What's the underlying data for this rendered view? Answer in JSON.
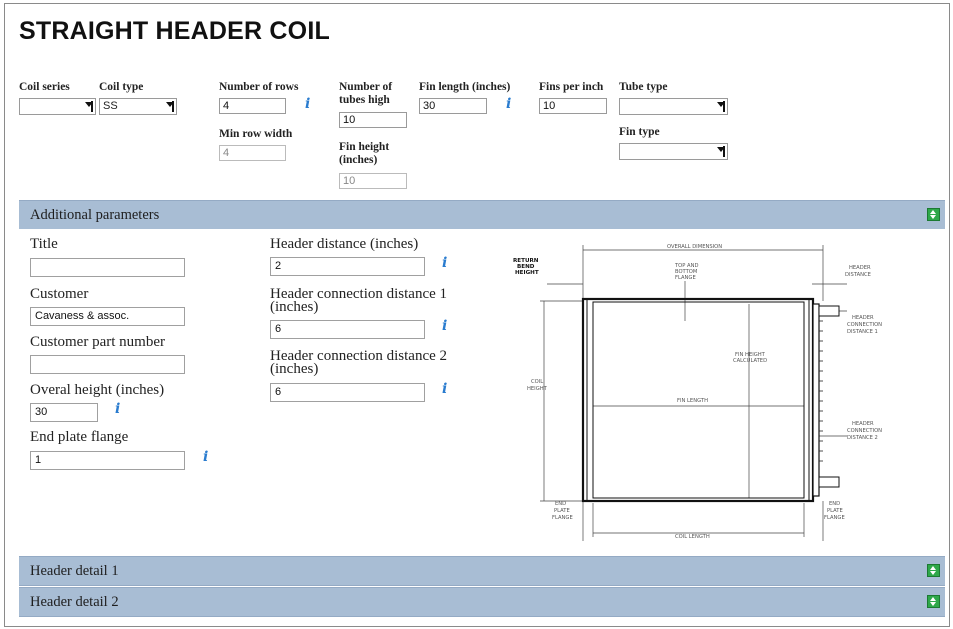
{
  "page_title": "STRAIGHT HEADER COIL",
  "top_fields": {
    "coil_series": {
      "label": "Coil series",
      "value": ""
    },
    "coil_type": {
      "label": "Coil type",
      "value": "SS"
    },
    "number_of_rows": {
      "label": "Number of rows",
      "value": "4"
    },
    "min_row_width": {
      "label": "Min row width",
      "value": "4"
    },
    "number_of_tubes_high": {
      "label_line1": "Number of",
      "label_line2": "tubes high",
      "value": "10"
    },
    "fin_height": {
      "label_line1": "Fin height",
      "label_line2": "(inches)",
      "value": "10"
    },
    "fin_length": {
      "label": "Fin length (inches)",
      "value": "30"
    },
    "fins_per_inch": {
      "label": "Fins per inch",
      "value": "10"
    },
    "tube_type": {
      "label": "Tube type",
      "value": ""
    },
    "fin_type": {
      "label": "Fin type",
      "value": ""
    }
  },
  "sections": {
    "additional": "Additional parameters",
    "header1": "Header detail 1",
    "header2": "Header detail 2"
  },
  "additional_params": {
    "title": {
      "label": "Title",
      "value": ""
    },
    "customer": {
      "label": "Customer",
      "value": "Cavaness & assoc."
    },
    "customer_part_number": {
      "label": "Customer part number",
      "value": ""
    },
    "overall_height": {
      "label": "Overal height (inches)",
      "value": "30"
    },
    "end_plate_flange": {
      "label": "End plate flange",
      "value": "1"
    },
    "header_distance": {
      "label": "Header distance (inches)",
      "value": "2"
    },
    "header_connection_distance_1": {
      "label_line1": "Header connection distance 1",
      "label_line2": "(inches)",
      "value": "6"
    },
    "header_connection_distance_2": {
      "label_line1": "Header connection distance 2",
      "label_line2": "(inches)",
      "value": "6"
    }
  },
  "diagram_labels": {
    "overall_dimension": "OVERALL DIMENSION",
    "return_bend_height": [
      "RETURN",
      "BEND",
      "HEIGHT"
    ],
    "top_bottom_flange": [
      "TOP AND",
      "BOTTOM",
      "FLANGE"
    ],
    "header_distance": [
      "HEADER",
      "DISTANCE"
    ],
    "header_connection_distance_1": [
      "HEADER",
      "CONNECTION",
      "DISTANCE 1"
    ],
    "fin_height_calculated": [
      "FIN HEIGHT",
      "CALCULATED"
    ],
    "coil_height": [
      "COIL",
      "HEIGHT"
    ],
    "fin_length": "FIN LENGTH",
    "header_connection_distance_2": [
      "HEADER",
      "CONNECTION",
      "DISTANCE 2"
    ],
    "end_plate_flange_left": [
      "END",
      "PLATE",
      "FLANGE"
    ],
    "end_plate_flange_right": [
      "END",
      "PLATE",
      "FLANGE"
    ],
    "coil_length": "COIL LENGTH"
  },
  "icons": {
    "info": "i"
  },
  "colors": {
    "section_bar": "#a8bdd4",
    "toggle": "#2ea84a",
    "info": "#2a7ccf"
  }
}
